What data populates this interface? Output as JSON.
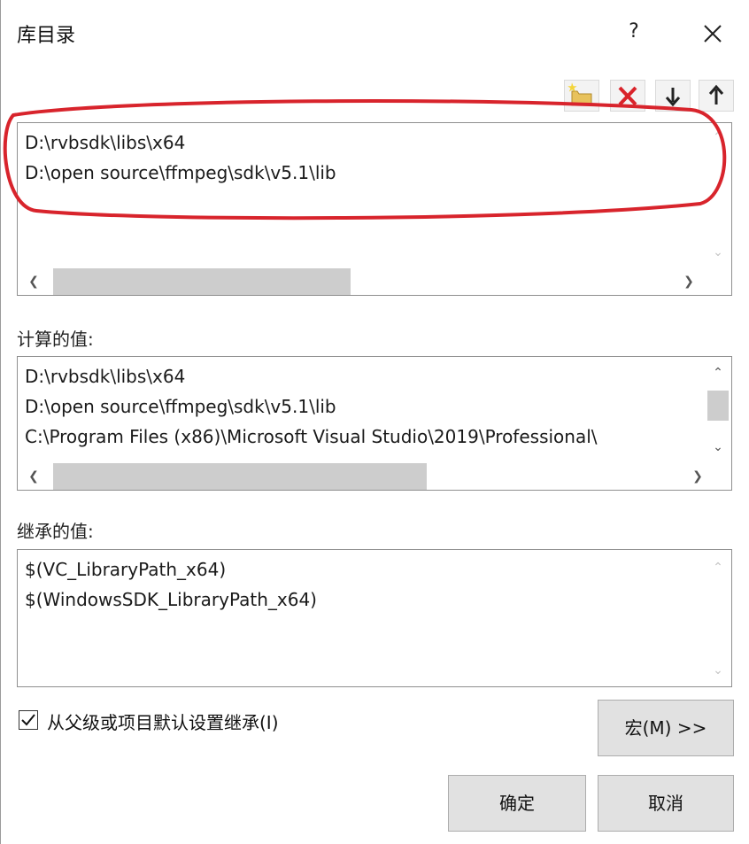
{
  "window": {
    "title": "库目录",
    "help_label": "?",
    "close_icon": "close-icon"
  },
  "toolbar": {
    "buttons": [
      {
        "name": "new-line-icon",
        "tooltip": ""
      },
      {
        "name": "delete-icon",
        "tooltip": ""
      },
      {
        "name": "move-down-icon",
        "tooltip": ""
      },
      {
        "name": "move-up-icon",
        "tooltip": ""
      }
    ]
  },
  "directories": {
    "items": [
      "D:\\rvbsdk\\libs\\x64",
      "D:\\open source\\ffmpeg\\sdk\\v5.1\\lib"
    ]
  },
  "evaluated": {
    "label": "计算的值:",
    "items": [
      "D:\\rvbsdk\\libs\\x64",
      "D:\\open source\\ffmpeg\\sdk\\v5.1\\lib",
      "C:\\Program Files (x86)\\Microsoft Visual Studio\\2019\\Professional\\"
    ]
  },
  "inherited": {
    "label": "继承的值:",
    "items": [
      "$(VC_LibraryPath_x64)",
      "$(WindowsSDK_LibraryPath_x64)"
    ]
  },
  "inherit_checkbox": {
    "label": "从父级或项目默认设置继承(I)",
    "checked": true
  },
  "buttons": {
    "macros": "宏(M) >>",
    "ok": "确定",
    "cancel": "取消"
  },
  "colors": {
    "annotation": "#d8242c",
    "delete": "#d9232a"
  }
}
